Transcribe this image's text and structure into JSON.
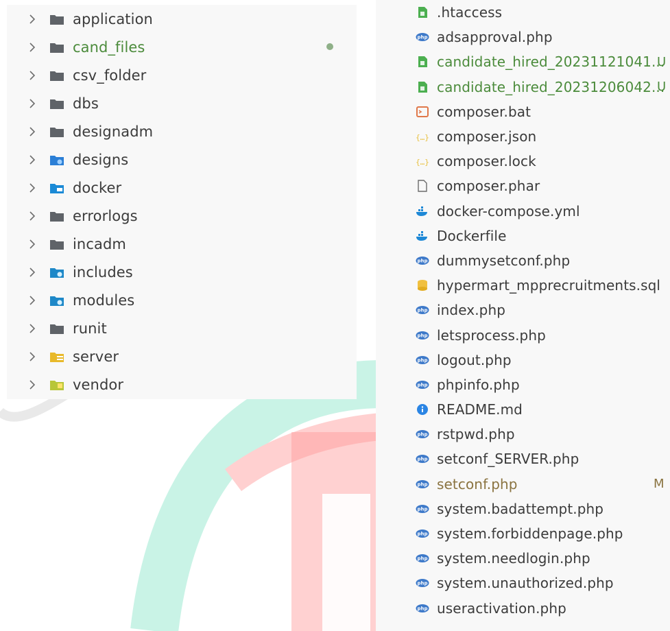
{
  "left_explorer": {
    "folders": [
      {
        "name": "application",
        "icon": "folder-icon",
        "color": "#5f6368"
      },
      {
        "name": "cand_files",
        "icon": "folder-icon",
        "color": "#5f6368",
        "highlight": "green",
        "has_dot": true
      },
      {
        "name": "csv_folder",
        "icon": "folder-icon",
        "color": "#5f6368"
      },
      {
        "name": "dbs",
        "icon": "folder-icon",
        "color": "#5f6368"
      },
      {
        "name": "designadm",
        "icon": "folder-icon",
        "color": "#5f6368"
      },
      {
        "name": "designs",
        "icon": "folder-designs-icon",
        "color": "#2b7fd6"
      },
      {
        "name": "docker",
        "icon": "folder-docker-icon",
        "color": "#1b8ad6"
      },
      {
        "name": "errorlogs",
        "icon": "folder-icon",
        "color": "#5f6368"
      },
      {
        "name": "incadm",
        "icon": "folder-icon",
        "color": "#5f6368"
      },
      {
        "name": "includes",
        "icon": "folder-includes-icon",
        "color": "#1e88c8"
      },
      {
        "name": "modules",
        "icon": "folder-modules-icon",
        "color": "#1e88c8"
      },
      {
        "name": "runit",
        "icon": "folder-icon",
        "color": "#5f6368"
      },
      {
        "name": "server",
        "icon": "folder-server-icon",
        "color": "#e8b92a"
      },
      {
        "name": "vendor",
        "icon": "folder-vendor-icon",
        "color": "#b8c638"
      }
    ]
  },
  "right_explorer": {
    "files": [
      {
        "name": ".htaccess",
        "icon": "htaccess-icon",
        "color": "#4caf50"
      },
      {
        "name": "adsapproval.php",
        "icon": "php-icon",
        "color": "#3d79c9"
      },
      {
        "name": "candidate_hired_20231121041...",
        "icon": "excel-icon",
        "color": "#4caf50",
        "highlight": "green",
        "status": "U"
      },
      {
        "name": "candidate_hired_20231206042...",
        "icon": "excel-icon",
        "color": "#4caf50",
        "highlight": "green",
        "status": "U"
      },
      {
        "name": "composer.bat",
        "icon": "terminal-icon",
        "color": "#e0784a"
      },
      {
        "name": "composer.json",
        "icon": "braces-icon",
        "color": "#e8c040"
      },
      {
        "name": "composer.lock",
        "icon": "braces-icon",
        "color": "#e8c040"
      },
      {
        "name": "composer.phar",
        "icon": "file-icon",
        "color": "#6b6b6b"
      },
      {
        "name": "docker-compose.yml",
        "icon": "docker-icon",
        "color": "#1e88d6"
      },
      {
        "name": "Dockerfile",
        "icon": "docker-icon",
        "color": "#1e88d6"
      },
      {
        "name": "dummysetconf.php",
        "icon": "php-icon",
        "color": "#3d79c9"
      },
      {
        "name": "hypermart_mpprecruitments.sql",
        "icon": "database-icon",
        "color": "#f0c040"
      },
      {
        "name": "index.php",
        "icon": "php-icon",
        "color": "#3d79c9"
      },
      {
        "name": "letsprocess.php",
        "icon": "php-icon",
        "color": "#3d79c9"
      },
      {
        "name": "logout.php",
        "icon": "php-icon",
        "color": "#3d79c9"
      },
      {
        "name": "phpinfo.php",
        "icon": "php-icon",
        "color": "#3d79c9"
      },
      {
        "name": "README.md",
        "icon": "info-icon",
        "color": "#2b85e4"
      },
      {
        "name": "rstpwd.php",
        "icon": "php-icon",
        "color": "#3d79c9"
      },
      {
        "name": "setconf_SERVER.php",
        "icon": "php-icon",
        "color": "#3d79c9"
      },
      {
        "name": "setconf.php",
        "icon": "php-icon",
        "color": "#3d79c9",
        "highlight": "yellow",
        "status": "M"
      },
      {
        "name": "system.badattempt.php",
        "icon": "php-icon",
        "color": "#3d79c9"
      },
      {
        "name": "system.forbiddenpage.php",
        "icon": "php-icon",
        "color": "#3d79c9"
      },
      {
        "name": "system.needlogin.php",
        "icon": "php-icon",
        "color": "#3d79c9"
      },
      {
        "name": "system.unauthorized.php",
        "icon": "php-icon",
        "color": "#3d79c9"
      },
      {
        "name": "useractivation.php",
        "icon": "php-icon",
        "color": "#3d79c9"
      }
    ]
  }
}
